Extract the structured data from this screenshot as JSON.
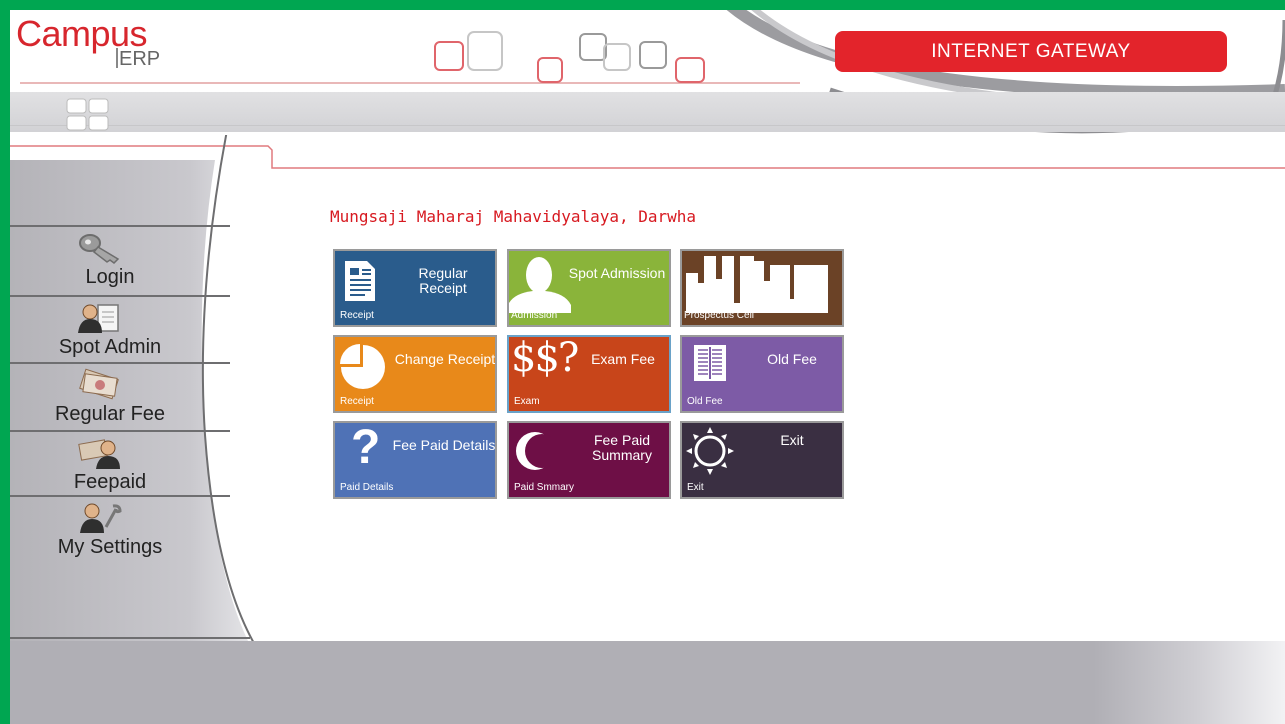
{
  "header": {
    "logo_main": "Campus",
    "logo_sub": "ERP",
    "gateway_label": "INTERNET GATEWAY"
  },
  "sidebar": {
    "items": [
      {
        "label": "Login",
        "icon": "key-icon"
      },
      {
        "label": "Spot Admin",
        "icon": "users-document-icon"
      },
      {
        "label": "Regular Fee",
        "icon": "money-icon"
      },
      {
        "label": "Feepaid",
        "icon": "money-user-icon"
      },
      {
        "label": "My Settings",
        "icon": "user-settings-icon"
      }
    ]
  },
  "main": {
    "college_name": "Mungsaji Maharaj Mahavidyalaya, Darwha",
    "tiles": [
      {
        "title": "Regular Receipt",
        "sub": "Receipt",
        "color": "#2a5c8c",
        "icon": "document-icon"
      },
      {
        "title": "Spot Admission",
        "sub": "Admission",
        "color": "#8ab43a",
        "icon": "person-icon"
      },
      {
        "title": "",
        "sub": "Prospectus Cell",
        "color": "#6b4226",
        "icon": "building-icon"
      },
      {
        "title": "Change Receipt",
        "sub": "Receipt",
        "color": "#e8891a",
        "icon": "pie-icon"
      },
      {
        "title": "Exam Fee",
        "sub": "Exam",
        "color": "#c8451a",
        "icon": "dollar-icon",
        "icon_text": "$$?"
      },
      {
        "title": "Old Fee",
        "sub": "Old Fee",
        "color": "#7d5ba6",
        "icon": "book-icon"
      },
      {
        "title": "Fee Paid Details",
        "sub": "Paid Details",
        "color": "#4f72b6",
        "icon": "question-icon",
        "icon_text": "?"
      },
      {
        "title": "Fee Paid Summary",
        "sub": "Paid Smmary",
        "color": "#6e0f46",
        "icon": "moon-icon"
      },
      {
        "title": "Exit",
        "sub": "Exit",
        "color": "#3a2f42",
        "icon": "sun-icon"
      }
    ]
  },
  "colors": {
    "frame": "#00a651",
    "accent_red": "#e3242b",
    "college_name": "#d71920"
  }
}
